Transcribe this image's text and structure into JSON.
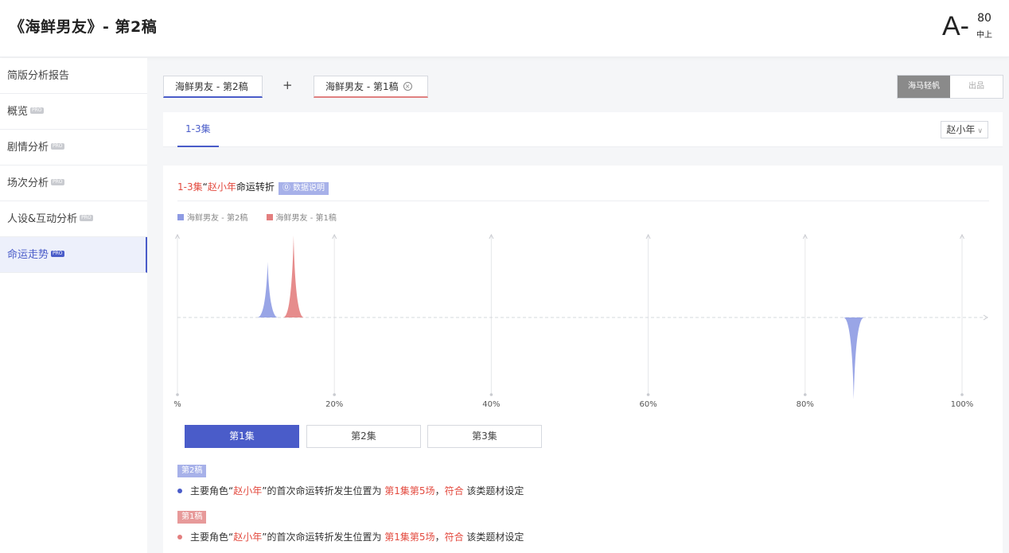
{
  "header": {
    "title": "《海鲜男友》- 第2稿",
    "grade": "A-",
    "score": "80",
    "level": "中上"
  },
  "sidebar": {
    "items": [
      {
        "label": "简版分析报告",
        "pro": ""
      },
      {
        "label": "概览",
        "pro": "PRO"
      },
      {
        "label": "剧情分析",
        "pro": "PRO"
      },
      {
        "label": "场次分析",
        "pro": "PRO"
      },
      {
        "label": "人设&互动分析",
        "pro": "PRO"
      },
      {
        "label": "命运走势",
        "pro": "PRO"
      }
    ]
  },
  "compare": {
    "draft_a": "海鲜男友 - 第2稿",
    "plus": "+",
    "draft_b": "海鲜男友 - 第1稿",
    "close": "×"
  },
  "mode": {
    "option_a": "海马轻帆",
    "option_b": "出品"
  },
  "episode_tab": "1-3集",
  "character_select": {
    "value": "赵小年",
    "chevron": "∨"
  },
  "card": {
    "title_prefix": "1-3集",
    "title_q1": "“",
    "title_name": "赵小年",
    "title_suffix": "命运转折",
    "explain": "⓪ 数据说明",
    "legend_a": "海鲜男友 - 第2稿",
    "legend_b": "海鲜男友 - 第1稿"
  },
  "chart_data": {
    "type": "area",
    "x_tick_labels": [
      "%",
      "20%",
      "40%",
      "60%",
      "80%",
      "100%"
    ],
    "x_ticks": [
      0,
      20,
      40,
      60,
      80,
      100
    ],
    "series": [
      {
        "name": "海鲜男友 - 第2稿",
        "color": "#8e9be3",
        "peaks": [
          {
            "x": 11.5,
            "amp": 0.68
          },
          {
            "x": 86.2,
            "amp": -1.0
          }
        ]
      },
      {
        "name": "海鲜男友 - 第1稿",
        "color": "#e37f7f",
        "peaks": [
          {
            "x": 14.8,
            "amp": 1.0
          }
        ]
      }
    ]
  },
  "episodes": [
    "第1集",
    "第2集",
    "第3集"
  ],
  "notes": [
    {
      "tag": "第2稿",
      "tag_color": "#a7b1e9",
      "dot_color": "#4a5cc9",
      "p1": "主要角色“",
      "name": "赵小年",
      "p2": "”的首次命运转折发生位置为 ",
      "pos": "第1集第5场",
      "p3": "，",
      "fit": "符合",
      "p4": " 该类题材设定"
    },
    {
      "tag": "第1稿",
      "tag_color": "#e79a9a",
      "dot_color": "#e37f7f",
      "p1": "主要角色“",
      "name": "赵小年",
      "p2": "”的首次命运转折发生位置为 ",
      "pos": "第1集第5场",
      "p3": "，",
      "fit": "符合",
      "p4": " 该类题材设定"
    }
  ]
}
